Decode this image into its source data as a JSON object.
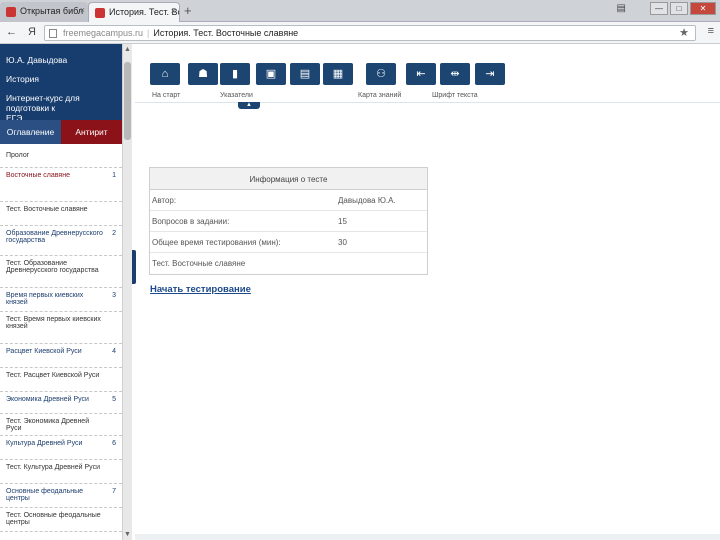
{
  "browser": {
    "tabs": [
      {
        "label": "Открытая библ",
        "active": false
      },
      {
        "label": "История. Тест. Во",
        "active": true
      }
    ],
    "tab_close": "×",
    "new_tab": "+",
    "address": {
      "host": "freemegacampus.ru",
      "title": "История. Тест. Восточные славяне"
    },
    "window_buttons": {
      "minimize": "—",
      "maximize": "□",
      "close": "✕"
    }
  },
  "sidebar": {
    "user_lines": [
      "Ю.А. Давыдова",
      "История",
      "Интернет-курс для подготовки к",
      "ЕГЭ"
    ],
    "tabs": [
      "Оглавление",
      "Антирит"
    ],
    "items": [
      {
        "label": "Пролог",
        "num": "",
        "kind": "plain"
      },
      {
        "label": "Восточные славяне",
        "num": "1",
        "kind": "main"
      },
      {
        "label": "Тест. Восточные славяне",
        "num": "",
        "kind": "plain"
      },
      {
        "label": "Образование Древнерусского государства",
        "num": "2",
        "kind": "topic"
      },
      {
        "label": "Тест. Образование Древнерусского государства",
        "num": "",
        "kind": "plain"
      },
      {
        "label": "Время первых киевских князей",
        "num": "3",
        "kind": "topic"
      },
      {
        "label": "Тест. Время первых киевских князей",
        "num": "",
        "kind": "plain"
      },
      {
        "label": "Расцвет Киевской Руси",
        "num": "4",
        "kind": "topic"
      },
      {
        "label": "Тест. Расцвет Киевской Руси",
        "num": "",
        "kind": "plain"
      },
      {
        "label": "Экономика Древней Руси",
        "num": "5",
        "kind": "topic"
      },
      {
        "label": "Тест. Экономика Древней Руси",
        "num": "",
        "kind": "plain"
      },
      {
        "label": "Культура Древней Руси",
        "num": "6",
        "kind": "topic"
      },
      {
        "label": "Тест. Культура Древней Руси",
        "num": "",
        "kind": "plain"
      },
      {
        "label": "Основные феодальные центры",
        "num": "7",
        "kind": "topic"
      },
      {
        "label": "Тест. Основные феодальные центры",
        "num": "",
        "kind": "plain"
      }
    ]
  },
  "toolbar": {
    "buttons": [
      {
        "name": "home",
        "icon": "⌂"
      },
      {
        "name": "users",
        "icon": "☗"
      },
      {
        "name": "index",
        "icon": "▮"
      },
      {
        "name": "case",
        "icon": "▣"
      },
      {
        "name": "doc",
        "icon": "▤"
      },
      {
        "name": "calendar",
        "icon": "▦"
      },
      {
        "name": "map",
        "icon": "⚇"
      },
      {
        "name": "font-decrease",
        "icon": "⇤"
      },
      {
        "name": "font-reset",
        "icon": "⇹"
      },
      {
        "name": "font-increase",
        "icon": "⇥"
      }
    ],
    "labels": {
      "home": "На старт",
      "index": "Указатели",
      "map": "Карта знаний",
      "font": "Шрифт текста"
    }
  },
  "info": {
    "title": "Информация о тесте",
    "rows": [
      {
        "label": "Автор:",
        "value": "Давыдова Ю.А."
      },
      {
        "label": "Вопросов в задании:",
        "value": "15"
      },
      {
        "label": "Общее время тестирования (мин):",
        "value": "30"
      },
      {
        "label": "Тест. Восточные славяне",
        "value": ""
      }
    ],
    "start_link": "Начать тестирование"
  }
}
